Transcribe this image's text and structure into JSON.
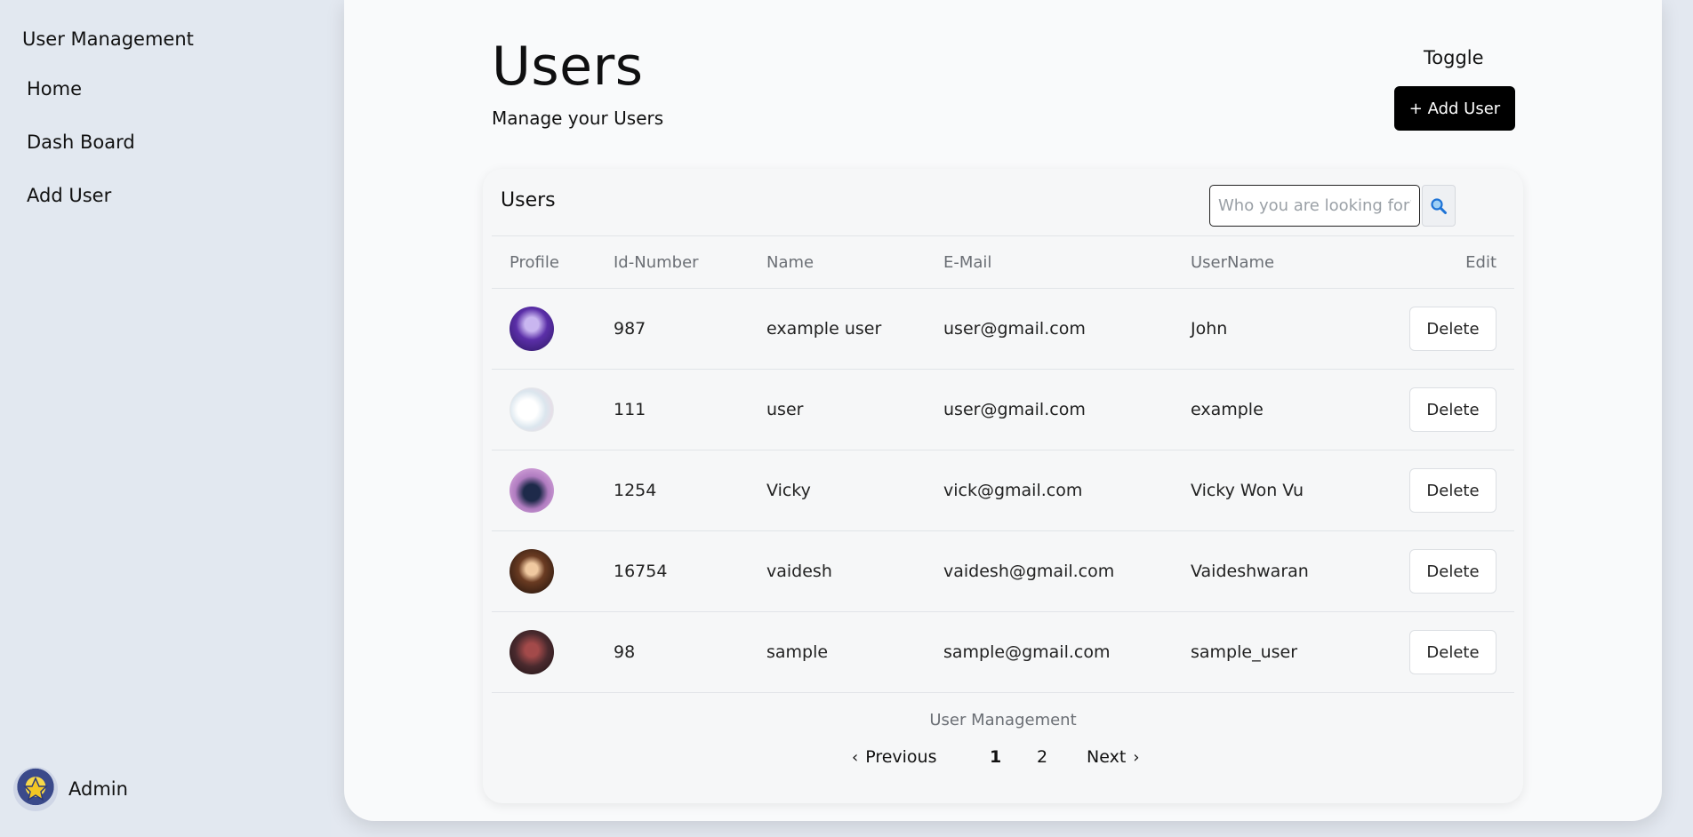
{
  "sidebar": {
    "brand": "User Management",
    "items": [
      {
        "label": "Home"
      },
      {
        "label": "Dash Board"
      },
      {
        "label": "Add User"
      }
    ],
    "admin_label": "Admin"
  },
  "header": {
    "title": "Users",
    "subtitle": "Manage your Users",
    "toggle_label": "Toggle",
    "add_user_label": "+ Add User"
  },
  "panel": {
    "title": "Users",
    "search": {
      "placeholder": "Who you are looking for?",
      "value": ""
    },
    "columns": [
      "Profile",
      "Id-Number",
      "Name",
      "E-Mail",
      "UserName",
      "Edit"
    ],
    "rows": [
      {
        "id": "987",
        "name": "example user",
        "email": "user@gmail.com",
        "username": "John",
        "action": "Delete",
        "avatar_color": "#5b2fa8"
      },
      {
        "id": "111",
        "name": "user",
        "email": "user@gmail.com",
        "username": "example",
        "action": "Delete",
        "avatar_color": "#eef2f6"
      },
      {
        "id": "1254",
        "name": "Vicky",
        "email": "vick@gmail.com",
        "username": "Vicky Won Vu",
        "action": "Delete",
        "avatar_color": "#c58cc8"
      },
      {
        "id": "16754",
        "name": "vaidesh",
        "email": "vaidesh@gmail.com",
        "username": "Vaideshwaran",
        "action": "Delete",
        "avatar_color": "#3a2418"
      },
      {
        "id": "98",
        "name": "sample",
        "email": "sample@gmail.com",
        "username": "sample_user",
        "action": "Delete",
        "avatar_color": "#3d2326"
      }
    ],
    "footer_label": "User Management",
    "pagination": {
      "previous": "Previous",
      "pages": [
        "1",
        "2"
      ],
      "current": "1",
      "next": "Next"
    }
  },
  "colors": {
    "sidebar_bg": "#e2e8f0",
    "primary_button": "#000000",
    "search_icon": "#1e73d6"
  }
}
